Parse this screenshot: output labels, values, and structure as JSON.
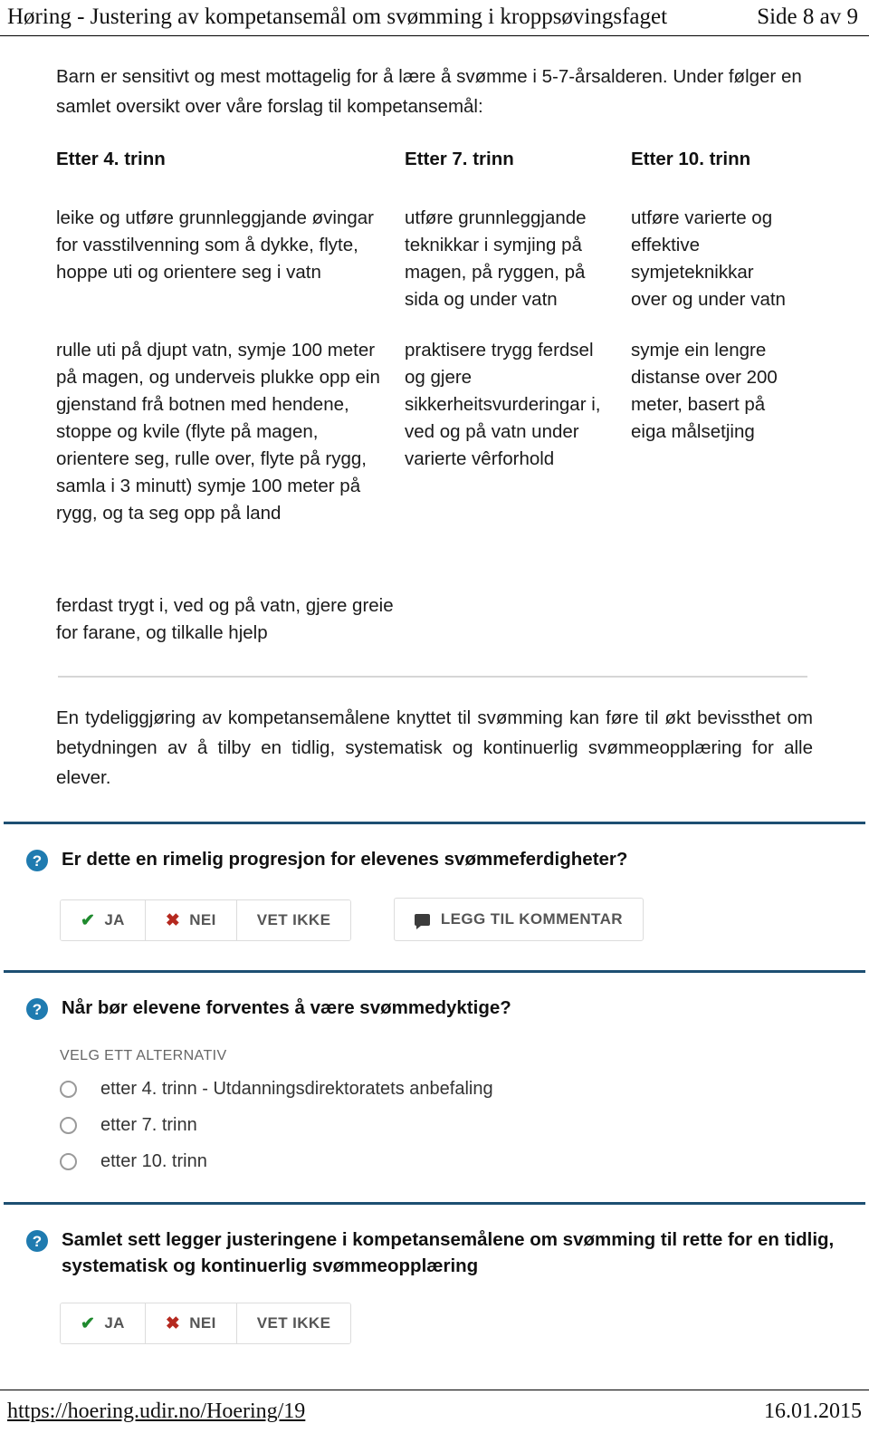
{
  "pdf": {
    "header_title": "Høring - Justering av kompetansemål om svømming i kroppsøvingsfaget",
    "header_page": "Side 8 av 9",
    "footer_url": "https://hoering.udir.no/Hoering/19",
    "footer_date": "16.01.2015"
  },
  "intro": "Barn er sensitivt og mest mottagelig for å lære å svømme i 5-7-årsalderen. Under følger en samlet oversikt over våre forslag til kompetansemål:",
  "goals": {
    "columns": [
      "Etter 4. trinn",
      "Etter 7. trinn",
      "Etter 10. trinn"
    ],
    "rows": [
      [
        "leike og utføre grunnleggjande øvingar for vasstilvenning som å dykke, flyte, hoppe uti og orientere seg i vatn",
        "utføre grunnleggjande teknikkar i symjing på magen, på ryggen, på sida og under vatn",
        "utføre varierte og effektive symjeteknikkar over og under vatn"
      ],
      [
        "rulle uti på djupt vatn, symje 100 meter på magen, og underveis plukke opp ein gjenstand frå botnen med hendene, stoppe og kvile (flyte på magen, orientere seg, rulle over, flyte på rygg, samla i 3 minutt) symje 100 meter på rygg, og ta seg opp på land",
        "praktisere trygg ferdsel og gjere sikkerheitsvurderingar i, ved og på vatn under varierte vêrforhold",
        "symje ein lengre distanse over 200 meter, basert på eiga målsetjing"
      ]
    ],
    "extra": "ferdast trygt i, ved og på vatn, gjere greie for farane, og tilkalle hjelp"
  },
  "summary": "En tydeliggjøring av kompetansemålene knyttet til svømming kan føre til økt bevissthet om betydningen av å tilby en tidlig, systematisk og kontinuerlig svømmeopplæring for alle elever.",
  "questions": [
    {
      "icon": "question-mark-icon",
      "title": "Er dette en rimelig progresjon for elevenes svømmeferdigheter?",
      "choices": [
        {
          "icon": "check-icon",
          "label": "JA"
        },
        {
          "icon": "cross-icon",
          "label": "NEI"
        },
        {
          "icon": "none",
          "label": "VET IKKE"
        }
      ],
      "comment_button": "LEGG TIL KOMMENTAR"
    },
    {
      "icon": "question-mark-icon",
      "title": "Når bør elevene forventes å være svømmedyktige?",
      "select_label": "VELG ETT ALTERNATIV",
      "options": [
        "etter 4. trinn - Utdanningsdirektoratets anbefaling",
        "etter 7. trinn",
        "etter 10. trinn"
      ]
    },
    {
      "icon": "question-mark-icon",
      "title": "Samlet sett legger justeringene i kompetansemålene om svømming til rette for en tidlig, systematisk og kontinuerlig svømmeopplæring",
      "choices": [
        {
          "icon": "check-icon",
          "label": "JA"
        },
        {
          "icon": "cross-icon",
          "label": "NEI"
        },
        {
          "icon": "none",
          "label": "VET IKKE"
        }
      ]
    }
  ],
  "colors": {
    "question_icon_blue": "#1f7bb0",
    "divider_blue": "#1d4f72",
    "check_green": "#1f8a2e",
    "cross_red": "#b5291f"
  }
}
